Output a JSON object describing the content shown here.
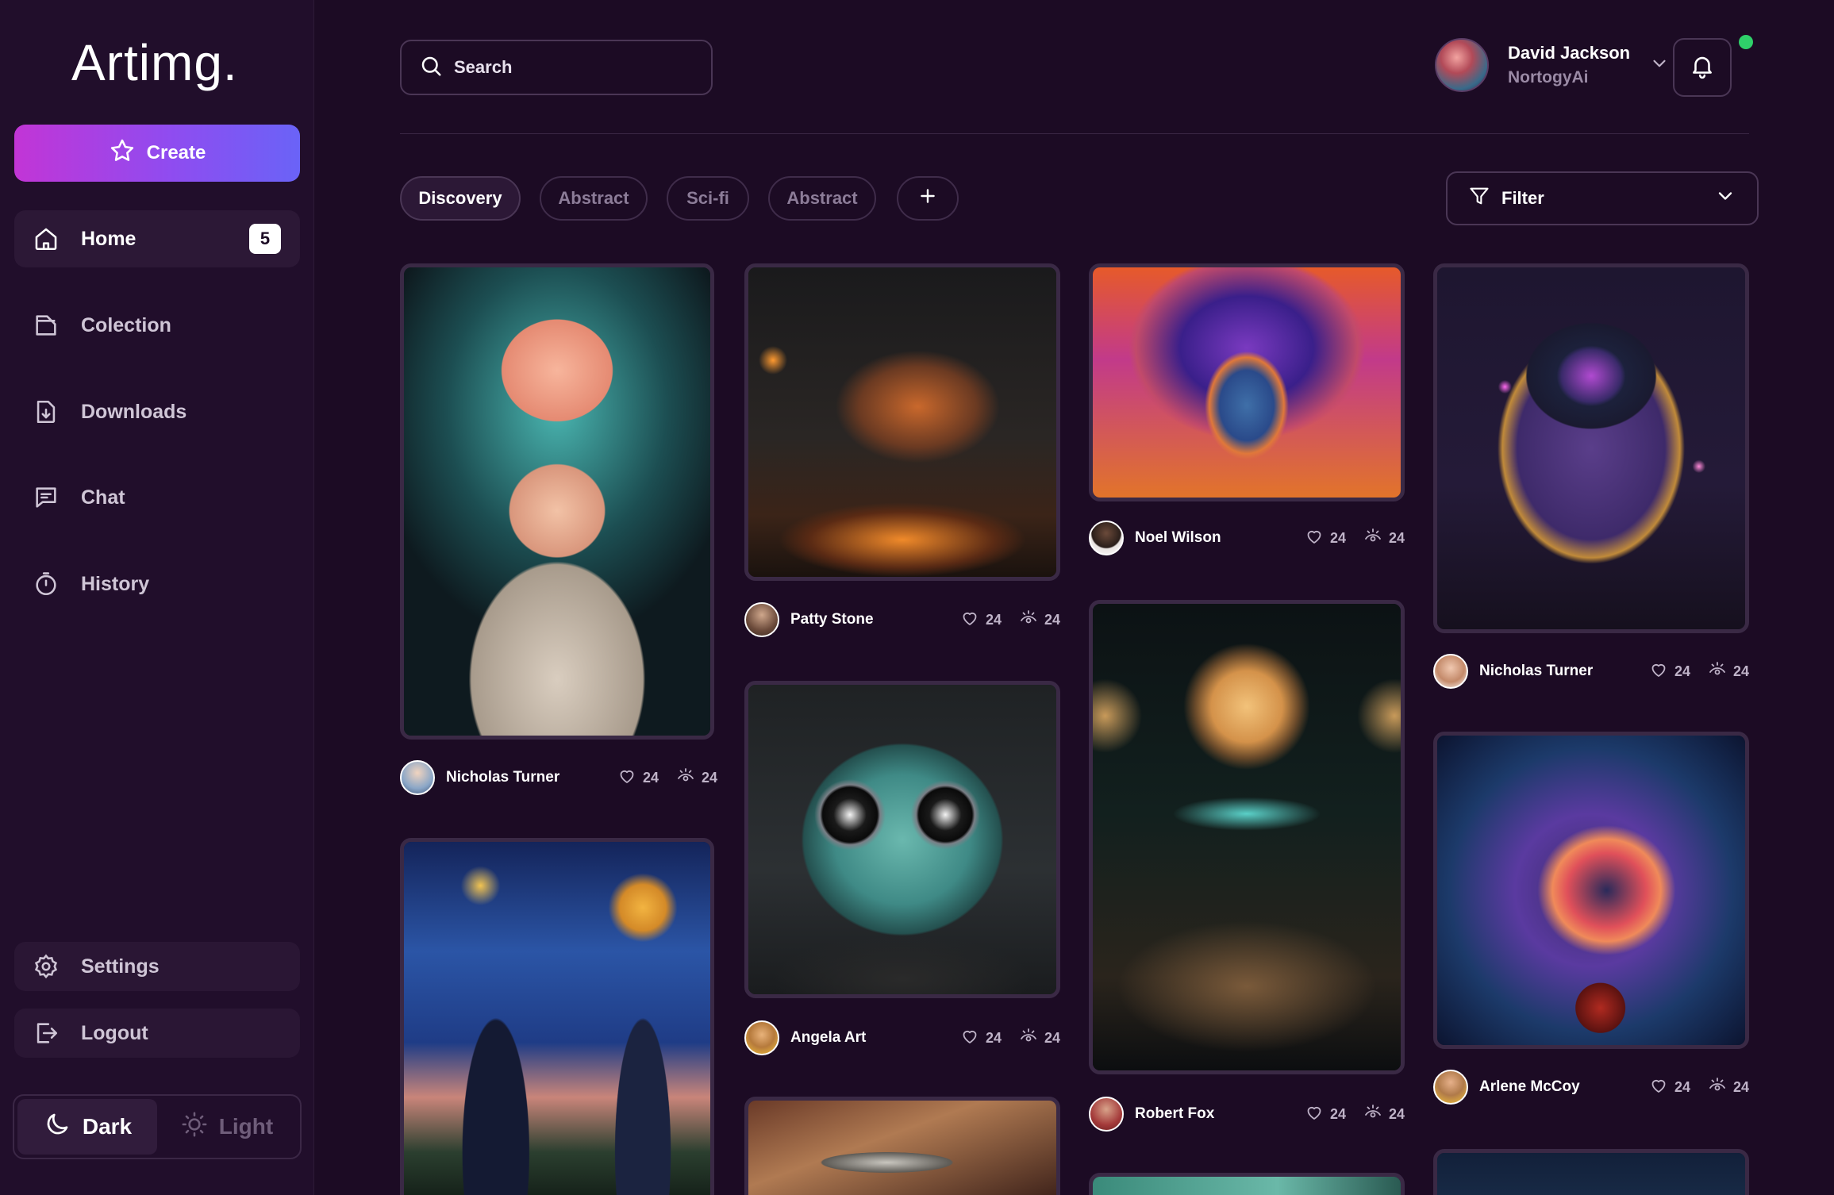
{
  "app": {
    "logo": "Artimg."
  },
  "sidebar": {
    "create_label": "Create",
    "items": [
      {
        "label": "Home",
        "icon": "home-icon",
        "badge": "5"
      },
      {
        "label": "Colection",
        "icon": "folder-icon"
      },
      {
        "label": "Downloads",
        "icon": "download-icon"
      },
      {
        "label": "Chat",
        "icon": "chat-icon"
      },
      {
        "label": "History",
        "icon": "timer-icon"
      }
    ],
    "bottom": [
      {
        "label": "Settings",
        "icon": "gear-icon"
      },
      {
        "label": "Logout",
        "icon": "logout-icon"
      }
    ],
    "theme": {
      "dark": "Dark",
      "light": "Light",
      "selected": "Dark"
    }
  },
  "search": {
    "placeholder": "Search"
  },
  "user": {
    "name": "David Jackson",
    "org": "NortogyAi",
    "online": true
  },
  "tags": [
    "Discovery",
    "Abstract",
    "Sci-fi",
    "Abstract"
  ],
  "filter": {
    "label": "Filter"
  },
  "cards": [
    {
      "author": "Nicholas Turner",
      "likes": "24",
      "views": "24"
    },
    {
      "author": "Patty Stone",
      "likes": "24",
      "views": "24"
    },
    {
      "author": "Angela Art",
      "likes": "24",
      "views": "24"
    },
    {
      "author": "Noel Wilson",
      "likes": "24",
      "views": "24"
    },
    {
      "author": "Robert Fox",
      "likes": "24",
      "views": "24"
    },
    {
      "author": "Nicholas Turner",
      "likes": "24",
      "views": "24"
    },
    {
      "author": "Arlene McCoy",
      "likes": "24",
      "views": "24"
    }
  ],
  "colors": {
    "accent_start": "#c235d6",
    "accent_end": "#6a63f7",
    "background": "#1c0b24",
    "online": "#2fd06a"
  }
}
